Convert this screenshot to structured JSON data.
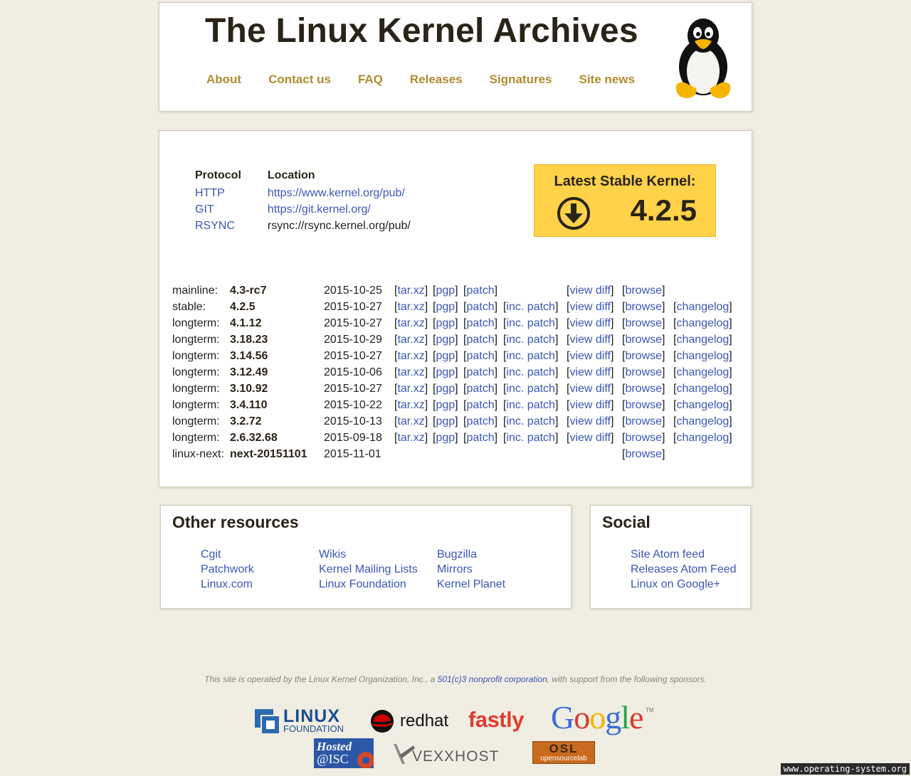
{
  "header": {
    "title": "The Linux Kernel Archives",
    "nav": [
      "About",
      "Contact us",
      "FAQ",
      "Releases",
      "Signatures",
      "Site news"
    ]
  },
  "protocols": {
    "headers": [
      "Protocol",
      "Location"
    ],
    "rows": [
      {
        "protocol": "HTTP",
        "location": "https://www.kernel.org/pub/",
        "location_link": true
      },
      {
        "protocol": "GIT",
        "location": "https://git.kernel.org/",
        "location_link": true
      },
      {
        "protocol": "RSYNC",
        "location": "rsync://rsync.kernel.org/pub/",
        "location_link": false
      }
    ]
  },
  "latest": {
    "title": "Latest Stable Kernel:",
    "version": "4.2.5",
    "icon": "download-circle-icon",
    "bg_color": "#ffd24a"
  },
  "releases": [
    {
      "type": "mainline:",
      "version": "4.3-rc7",
      "date": "2015-10-25",
      "links": {
        "tar": "tar.xz",
        "pgp": "pgp",
        "patch": "patch",
        "inc": null,
        "diff": "view diff",
        "browse": "browse",
        "changelog": null
      }
    },
    {
      "type": "stable:",
      "version": "4.2.5",
      "date": "2015-10-27",
      "links": {
        "tar": "tar.xz",
        "pgp": "pgp",
        "patch": "patch",
        "inc": "inc. patch",
        "diff": "view diff",
        "browse": "browse",
        "changelog": "changelog"
      }
    },
    {
      "type": "longterm:",
      "version": "4.1.12",
      "date": "2015-10-27",
      "links": {
        "tar": "tar.xz",
        "pgp": "pgp",
        "patch": "patch",
        "inc": "inc. patch",
        "diff": "view diff",
        "browse": "browse",
        "changelog": "changelog"
      }
    },
    {
      "type": "longterm:",
      "version": "3.18.23",
      "date": "2015-10-29",
      "links": {
        "tar": "tar.xz",
        "pgp": "pgp",
        "patch": "patch",
        "inc": "inc. patch",
        "diff": "view diff",
        "browse": "browse",
        "changelog": "changelog"
      }
    },
    {
      "type": "longterm:",
      "version": "3.14.56",
      "date": "2015-10-27",
      "links": {
        "tar": "tar.xz",
        "pgp": "pgp",
        "patch": "patch",
        "inc": "inc. patch",
        "diff": "view diff",
        "browse": "browse",
        "changelog": "changelog"
      }
    },
    {
      "type": "longterm:",
      "version": "3.12.49",
      "date": "2015-10-06",
      "links": {
        "tar": "tar.xz",
        "pgp": "pgp",
        "patch": "patch",
        "inc": "inc. patch",
        "diff": "view diff",
        "browse": "browse",
        "changelog": "changelog"
      }
    },
    {
      "type": "longterm:",
      "version": "3.10.92",
      "date": "2015-10-27",
      "links": {
        "tar": "tar.xz",
        "pgp": "pgp",
        "patch": "patch",
        "inc": "inc. patch",
        "diff": "view diff",
        "browse": "browse",
        "changelog": "changelog"
      }
    },
    {
      "type": "longterm:",
      "version": "3.4.110",
      "date": "2015-10-22",
      "links": {
        "tar": "tar.xz",
        "pgp": "pgp",
        "patch": "patch",
        "inc": "inc. patch",
        "diff": "view diff",
        "browse": "browse",
        "changelog": "changelog"
      }
    },
    {
      "type": "longterm:",
      "version": "3.2.72",
      "date": "2015-10-13",
      "links": {
        "tar": "tar.xz",
        "pgp": "pgp",
        "patch": "patch",
        "inc": "inc. patch",
        "diff": "view diff",
        "browse": "browse",
        "changelog": "changelog"
      }
    },
    {
      "type": "longterm:",
      "version": "2.6.32.68",
      "date": "2015-09-18",
      "links": {
        "tar": "tar.xz",
        "pgp": "pgp",
        "patch": "patch",
        "inc": "inc. patch",
        "diff": "view diff",
        "browse": "browse",
        "changelog": "changelog"
      }
    },
    {
      "type": "linux-next:",
      "version": "next-20151101",
      "date": "2015-11-01",
      "links": {
        "tar": null,
        "pgp": null,
        "patch": null,
        "inc": null,
        "diff": null,
        "browse": "browse",
        "changelog": null
      }
    }
  ],
  "other_resources": {
    "title": "Other resources",
    "columns": [
      [
        "Cgit",
        "Patchwork",
        "Linux.com"
      ],
      [
        "Wikis",
        "Kernel Mailing Lists",
        "Linux Foundation"
      ],
      [
        "Bugzilla",
        "Mirrors",
        "Kernel Planet"
      ]
    ]
  },
  "social": {
    "title": "Social",
    "links": [
      "Site Atom feed",
      "Releases Atom Feed",
      "Linux on Google+"
    ]
  },
  "footer": {
    "text_before": "This site is operated by the Linux Kernel Organization, Inc., a ",
    "link": "501(c)3 nonprofit corporation",
    "text_after": ", with support from the following sponsors."
  },
  "sponsors": {
    "linux_foundation": [
      "LINUX",
      "FOUNDATION"
    ],
    "redhat": "redhat",
    "fastly": "fastly",
    "google": [
      "G",
      "o",
      "o",
      "g",
      "l",
      "e"
    ],
    "google_tm": "TM",
    "isc": [
      "Hosted",
      "@ISC"
    ],
    "vexxhost": "VEXXHOST",
    "osl": [
      "OSL",
      "opensourcelab"
    ]
  },
  "watermark": "www.operating-system.org"
}
